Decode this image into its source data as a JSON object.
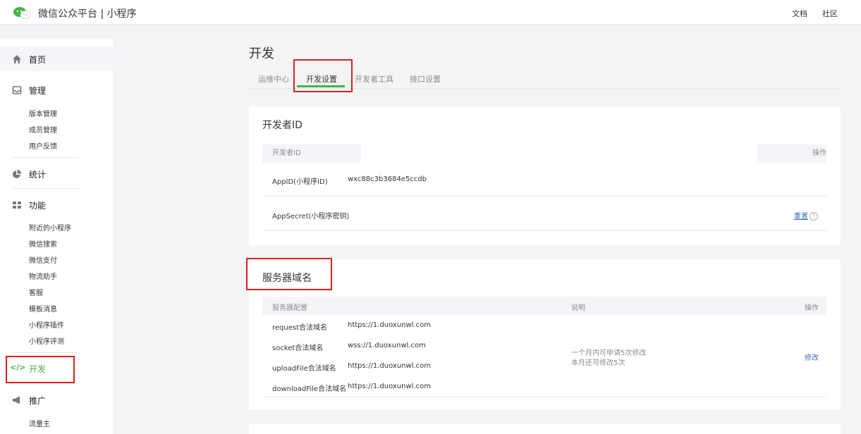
{
  "header": {
    "brand": "微信公众平台 | 小程序",
    "links": [
      "文档",
      "社区"
    ]
  },
  "sidebar": {
    "home": "首页",
    "manage": {
      "label": "管理",
      "items": [
        "版本管理",
        "成员管理",
        "用户反馈"
      ]
    },
    "stats": "统计",
    "features": {
      "label": "功能",
      "items": [
        "附近的小程序",
        "微信搜索",
        "微信支付",
        "物流助手",
        "客服",
        "模板消息",
        "小程序插件",
        "小程序评测"
      ]
    },
    "develop": "开发",
    "promote": {
      "label": "推广",
      "items": [
        "流量主"
      ]
    }
  },
  "main": {
    "title": "开发",
    "tabs": [
      "运维中心",
      "开发设置",
      "开发者工具",
      "接口设置"
    ],
    "developer_id": {
      "title": "开发者ID",
      "col_id": "开发者ID",
      "col_action": "操作",
      "appid_label": "AppID(小程序ID)",
      "appid_value": "wxc88c3b3684e5ccdb",
      "secret_label": "AppSecret(小程序密钥)",
      "reset_label": "重置",
      "help": "?"
    },
    "server_domain": {
      "title": "服务器域名",
      "col_config": "服务器配置",
      "col_desc": "说明",
      "col_action": "操作",
      "rows": [
        {
          "label": "request合法域名",
          "value": "https://1.duoxunwl.com"
        },
        {
          "label": "socket合法域名",
          "value": "wss://1.duoxunwl.com"
        },
        {
          "label": "uploadFile合法域名",
          "value": "https://1.duoxunwl.com"
        },
        {
          "label": "downloadFile合法域名",
          "value": "https://1.duoxunwl.com"
        }
      ],
      "desc_line1": "一个月内可申请5次修改",
      "desc_line2": "本月还可修改5次",
      "edit_label": "修改"
    }
  },
  "colors": {
    "accent": "#44b549",
    "highlight": "#e02020",
    "link": "#3e6dba"
  }
}
